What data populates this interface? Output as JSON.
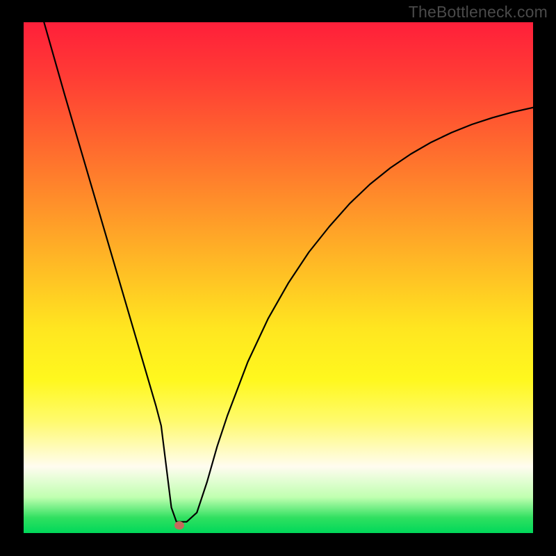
{
  "watermark": "TheBottleneck.com",
  "chart_data": {
    "type": "line",
    "title": "",
    "xlabel": "",
    "ylabel": "",
    "xlim": [
      0,
      100
    ],
    "ylim": [
      0,
      100
    ],
    "series": [
      {
        "name": "bottleneck-curve",
        "x": [
          4,
          6,
          8,
          10,
          12,
          14,
          16,
          18,
          20,
          22,
          24,
          26,
          27,
          28,
          29,
          30,
          31,
          32,
          34,
          36,
          38,
          40,
          44,
          48,
          52,
          56,
          60,
          64,
          68,
          72,
          76,
          80,
          84,
          88,
          92,
          96,
          100
        ],
        "values": [
          100,
          93,
          86,
          79.2,
          72.4,
          65.6,
          58.8,
          52,
          45.2,
          38.4,
          31.6,
          24.8,
          21,
          13,
          5,
          2.2,
          2.2,
          2.2,
          4,
          10,
          17,
          23,
          33.5,
          42,
          49,
          55,
          60,
          64.5,
          68.3,
          71.5,
          74.2,
          76.5,
          78.4,
          80,
          81.3,
          82.4,
          83.3
        ]
      }
    ],
    "marker": {
      "x": 30.5,
      "y": 1.5,
      "color": "#c56a5c"
    },
    "gradient_stops": [
      {
        "pct": 0,
        "color": "#ff1f3a"
      },
      {
        "pct": 50,
        "color": "#ffc324"
      },
      {
        "pct": 70,
        "color": "#fff81e"
      },
      {
        "pct": 100,
        "color": "#00d85a"
      }
    ]
  }
}
